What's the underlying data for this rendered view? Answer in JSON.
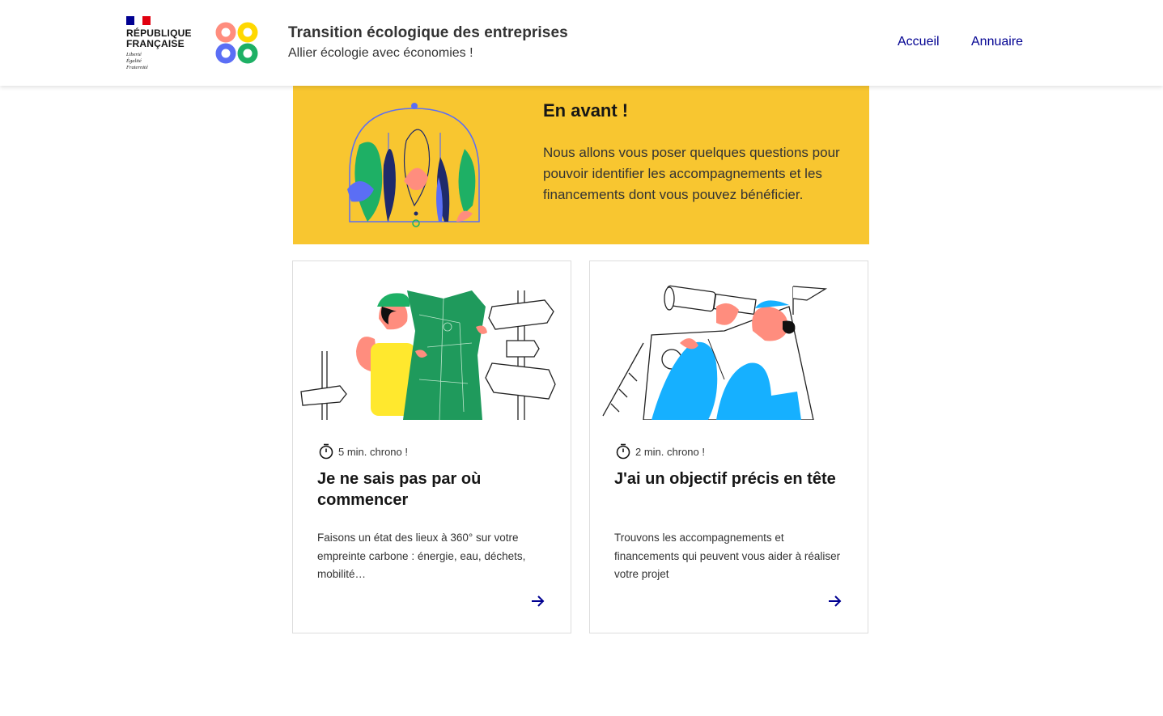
{
  "header": {
    "republic_name_line1": "RÉPUBLIQUE",
    "republic_name_line2": "FRANÇAISE",
    "motto": [
      "Liberté",
      "Égalité",
      "Fraternité"
    ],
    "title": "Transition écologique des entreprises",
    "tagline": "Allier écologie avec économies !",
    "nav": [
      {
        "label": "Accueil"
      },
      {
        "label": "Annuaire"
      }
    ]
  },
  "banner": {
    "title": "En avant !",
    "text": "Nous allons vous poser quelques questions pour pouvoir identifier les accompagnements et les financements dont vous pouvez bénéficier."
  },
  "cards": [
    {
      "duration": "5 min. chrono !",
      "title": "Je ne sais pas par où commencer",
      "description": "Faisons un état des lieux à 360° sur votre empreinte carbone : énergie, eau, déchets, mobilité…",
      "illustration": "explorer-with-map-and-signposts"
    },
    {
      "duration": "2 min. chrono !",
      "title": "J'ai un objectif précis en tête",
      "description": "Trouvons les accompagnements et financements qui peuvent vous aider à réaliser votre projet",
      "illustration": "sailor-with-telescope"
    }
  ],
  "colors": {
    "banner_bg": "#f8c630",
    "nav_link": "#000091",
    "flag_blue": "#000091",
    "flag_red": "#e1000f",
    "logo_orange": "#ff8d7e",
    "logo_yellow": "#ffd800",
    "logo_blue": "#5b6ef5",
    "logo_green": "#1eb065"
  },
  "icons": {
    "duration": "stopwatch-icon",
    "card_link": "arrow-right-icon"
  }
}
